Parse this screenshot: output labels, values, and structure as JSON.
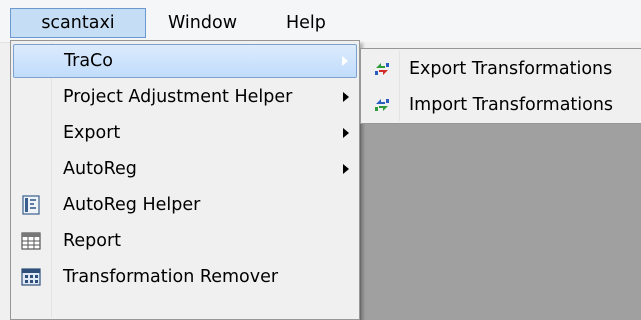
{
  "menubar": {
    "items": [
      {
        "label": "scantaxi"
      },
      {
        "label": "Window"
      },
      {
        "label": "Help"
      }
    ]
  },
  "dropdown": {
    "items": [
      {
        "label": "TraCo",
        "icon": "none",
        "submenu": true
      },
      {
        "label": "Project Adjustment Helper",
        "icon": "none",
        "submenu": true
      },
      {
        "label": "Export",
        "icon": "none",
        "submenu": true
      },
      {
        "label": "AutoReg",
        "icon": "none",
        "submenu": true
      },
      {
        "label": "AutoReg Helper",
        "icon": "autoreg-helper-icon",
        "submenu": false
      },
      {
        "label": "Report",
        "icon": "report-grid-icon",
        "submenu": false
      },
      {
        "label": "Transformation Remover",
        "icon": "transformation-remover-icon",
        "submenu": false
      }
    ]
  },
  "submenu": {
    "items": [
      {
        "label": "Export Transformations",
        "icon": "export-arrows-icon"
      },
      {
        "label": "Import Transformations",
        "icon": "import-arrows-icon"
      }
    ]
  },
  "colors": {
    "highlight": "#c5def5",
    "gray_area": "#a0a0a0"
  }
}
